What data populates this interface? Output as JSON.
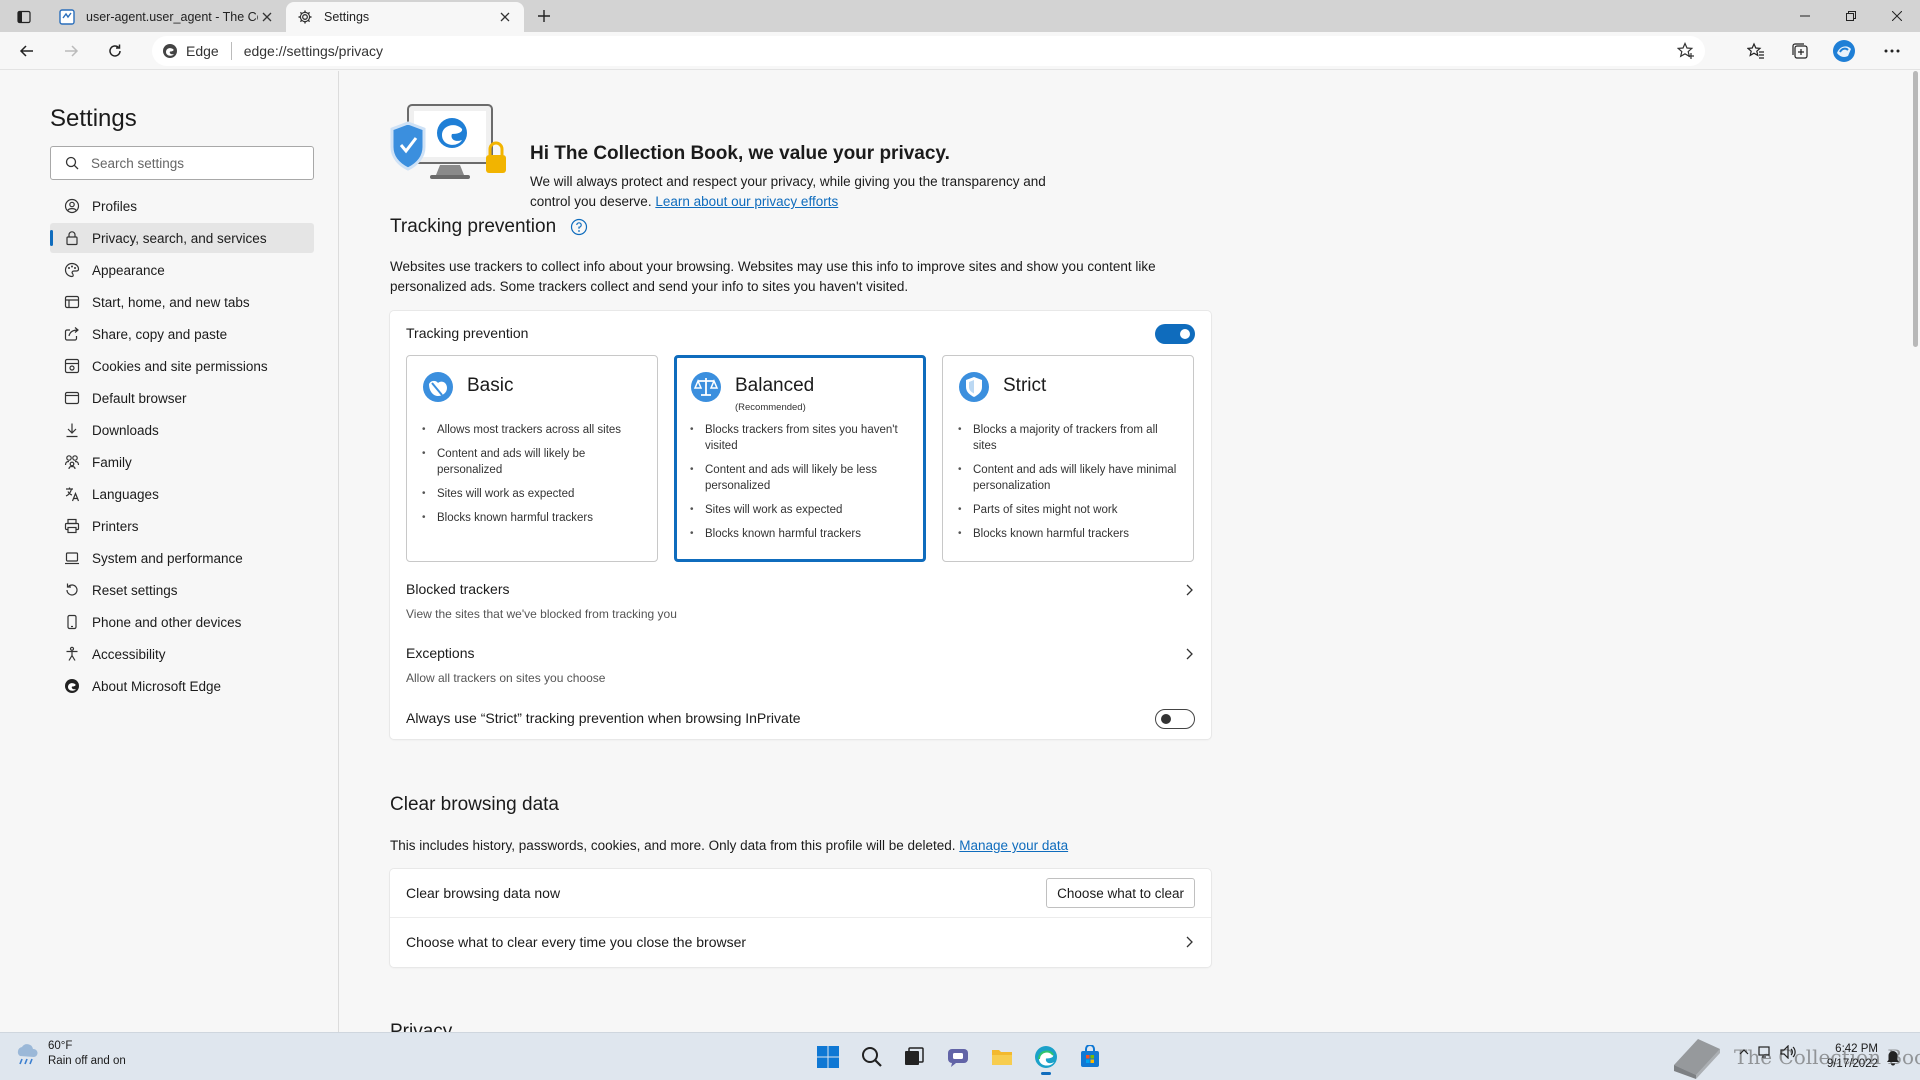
{
  "browser": {
    "tabs": [
      {
        "title": "user-agent.user_agent - The Coll",
        "active": false
      },
      {
        "title": "Settings",
        "active": true
      }
    ],
    "address": {
      "site_label": "Edge",
      "url": "edge://settings/privacy"
    }
  },
  "sidebar": {
    "title": "Settings",
    "search_placeholder": "Search settings",
    "items": [
      {
        "label": "Profiles",
        "icon": "profile-icon"
      },
      {
        "label": "Privacy, search, and services",
        "icon": "lock-icon",
        "selected": true
      },
      {
        "label": "Appearance",
        "icon": "appearance-icon"
      },
      {
        "label": "Start, home, and new tabs",
        "icon": "home-tabs-icon"
      },
      {
        "label": "Share, copy and paste",
        "icon": "share-icon"
      },
      {
        "label": "Cookies and site permissions",
        "icon": "cookies-icon"
      },
      {
        "label": "Default browser",
        "icon": "browser-icon"
      },
      {
        "label": "Downloads",
        "icon": "download-icon"
      },
      {
        "label": "Family",
        "icon": "family-icon"
      },
      {
        "label": "Languages",
        "icon": "language-icon"
      },
      {
        "label": "Printers",
        "icon": "printer-icon"
      },
      {
        "label": "System and performance",
        "icon": "laptop-icon"
      },
      {
        "label": "Reset settings",
        "icon": "reset-icon"
      },
      {
        "label": "Phone and other devices",
        "icon": "phone-icon"
      },
      {
        "label": "Accessibility",
        "icon": "accessibility-icon"
      },
      {
        "label": "About Microsoft Edge",
        "icon": "edge-logo-icon"
      }
    ]
  },
  "hero": {
    "title": "Hi The Collection Book, we value your privacy.",
    "text": "We will always protect and respect your privacy, while giving you the transparency and control you deserve.",
    "link": "Learn about our privacy efforts"
  },
  "tracking": {
    "heading": "Tracking prevention",
    "description": "Websites use trackers to collect info about your browsing. Websites may use this info to improve sites and show you content like personalized ads. Some trackers collect and send your info to sites you haven't visited.",
    "card_title": "Tracking prevention",
    "enabled": true,
    "options": [
      {
        "name": "Basic",
        "recommended": "",
        "selected": false,
        "bullets": [
          "Allows most trackers across all sites",
          "Content and ads will likely be personalized",
          "Sites will work as expected",
          "Blocks known harmful trackers"
        ]
      },
      {
        "name": "Balanced",
        "recommended": "(Recommended)",
        "selected": true,
        "bullets": [
          "Blocks trackers from sites you haven't visited",
          "Content and ads will likely be less personalized",
          "Sites will work as expected",
          "Blocks known harmful trackers"
        ]
      },
      {
        "name": "Strict",
        "recommended": "",
        "selected": false,
        "bullets": [
          "Blocks a majority of trackers from all sites",
          "Content and ads will likely have minimal personalization",
          "Parts of sites might not work",
          "Blocks known harmful trackers"
        ]
      }
    ],
    "blocked_title": "Blocked trackers",
    "blocked_sub": "View the sites that we've blocked from tracking you",
    "exceptions_title": "Exceptions",
    "exceptions_sub": "Allow all trackers on sites you choose",
    "inprivate_label": "Always use “Strict” tracking prevention when browsing InPrivate",
    "inprivate_enabled": false
  },
  "clear": {
    "heading": "Clear browsing data",
    "description": "This includes history, passwords, cookies, and more. Only data from this profile will be deleted.",
    "link": "Manage your data",
    "now_label": "Clear browsing data now",
    "button": "Choose what to clear",
    "every_time_label": "Choose what to clear every time you close the browser"
  },
  "next_heading": "Privacy",
  "taskbar": {
    "weather_temp": "60°F",
    "weather_desc": "Rain off and on",
    "time": "6:42 PM",
    "date": "9/17/2022",
    "watermark": "The Collection Book"
  },
  "colors": {
    "accent": "#0f6cbd",
    "page_bg": "#f7f7f7",
    "tabstrip_bg": "#d3d3d3",
    "taskbar_bg": "#dfe6ee"
  }
}
